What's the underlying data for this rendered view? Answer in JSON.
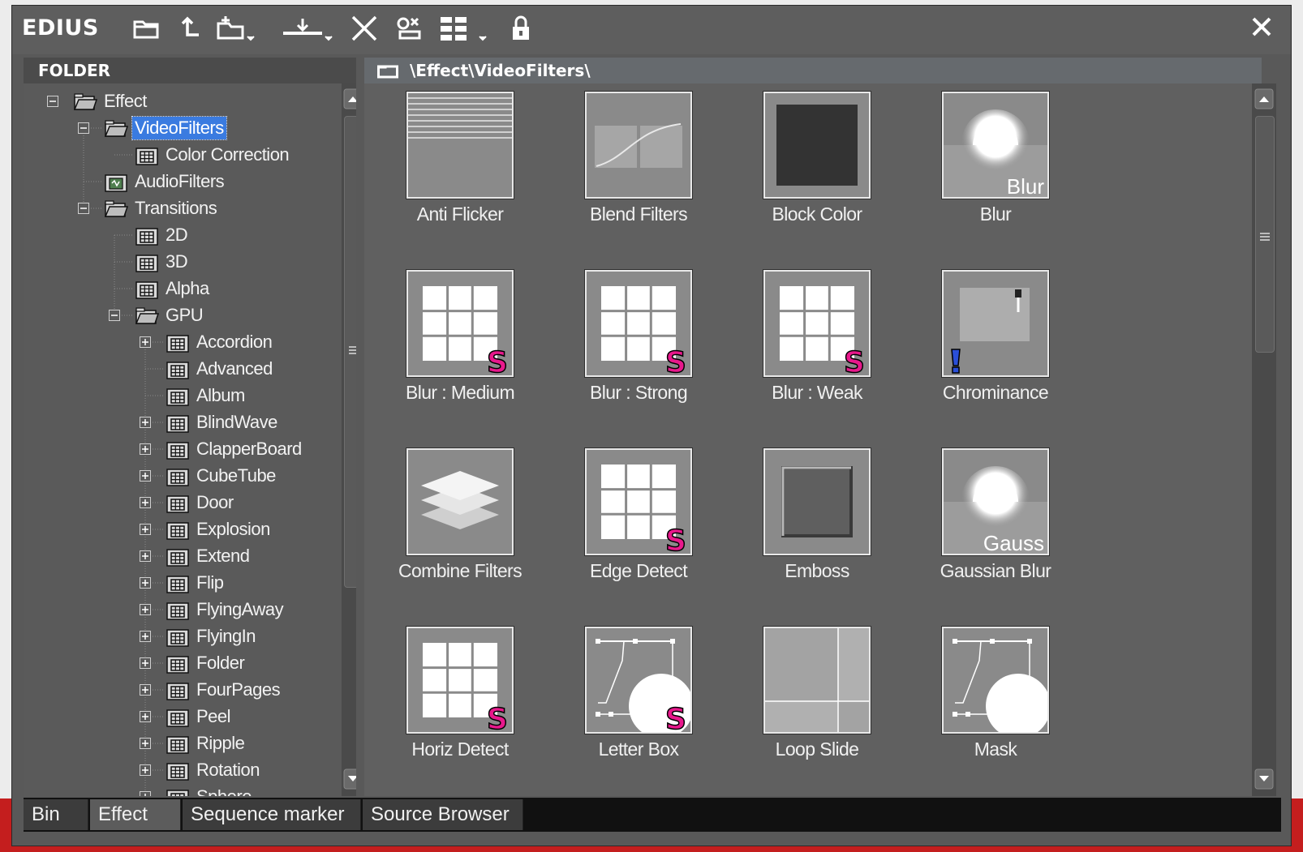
{
  "app": {
    "name": "EDIUS"
  },
  "toolbar": {
    "icons": [
      "folder-icon",
      "up-folder-icon",
      "new-folder-icon",
      "import-icon",
      "delete-icon",
      "properties-icon",
      "view-mode-icon",
      "lock-icon"
    ],
    "close_symbol": "✕"
  },
  "folder_panel": {
    "header": "FOLDER",
    "tree": [
      {
        "label": "Effect",
        "depth": 0,
        "expander": "minus",
        "icon": "open-folder"
      },
      {
        "label": "VideoFilters",
        "depth": 1,
        "expander": "minus",
        "icon": "open-folder",
        "selected": true
      },
      {
        "label": "Color Correction",
        "depth": 2,
        "expander": "none",
        "icon": "grid-folder"
      },
      {
        "label": "AudioFilters",
        "depth": 1,
        "expander": "none",
        "icon": "audio-folder"
      },
      {
        "label": "Transitions",
        "depth": 1,
        "expander": "minus",
        "icon": "open-folder"
      },
      {
        "label": "2D",
        "depth": 2,
        "expander": "none",
        "icon": "grid-folder"
      },
      {
        "label": "3D",
        "depth": 2,
        "expander": "none",
        "icon": "grid-folder"
      },
      {
        "label": "Alpha",
        "depth": 2,
        "expander": "none",
        "icon": "grid-folder"
      },
      {
        "label": "GPU",
        "depth": 2,
        "expander": "minus",
        "icon": "open-folder"
      },
      {
        "label": "Accordion",
        "depth": 3,
        "expander": "plus",
        "icon": "grid-folder"
      },
      {
        "label": "Advanced",
        "depth": 3,
        "expander": "none",
        "icon": "grid-folder"
      },
      {
        "label": "Album",
        "depth": 3,
        "expander": "none",
        "icon": "grid-folder"
      },
      {
        "label": "BlindWave",
        "depth": 3,
        "expander": "plus",
        "icon": "grid-folder"
      },
      {
        "label": "ClapperBoard",
        "depth": 3,
        "expander": "plus",
        "icon": "grid-folder"
      },
      {
        "label": "CubeTube",
        "depth": 3,
        "expander": "plus",
        "icon": "grid-folder"
      },
      {
        "label": "Door",
        "depth": 3,
        "expander": "plus",
        "icon": "grid-folder"
      },
      {
        "label": "Explosion",
        "depth": 3,
        "expander": "plus",
        "icon": "grid-folder"
      },
      {
        "label": "Extend",
        "depth": 3,
        "expander": "plus",
        "icon": "grid-folder"
      },
      {
        "label": "Flip",
        "depth": 3,
        "expander": "plus",
        "icon": "grid-folder"
      },
      {
        "label": "FlyingAway",
        "depth": 3,
        "expander": "plus",
        "icon": "grid-folder"
      },
      {
        "label": "FlyingIn",
        "depth": 3,
        "expander": "plus",
        "icon": "grid-folder"
      },
      {
        "label": "Folder",
        "depth": 3,
        "expander": "plus",
        "icon": "grid-folder"
      },
      {
        "label": "FourPages",
        "depth": 3,
        "expander": "plus",
        "icon": "grid-folder"
      },
      {
        "label": "Peel",
        "depth": 3,
        "expander": "plus",
        "icon": "grid-folder"
      },
      {
        "label": "Ripple",
        "depth": 3,
        "expander": "plus",
        "icon": "grid-folder"
      },
      {
        "label": "Rotation",
        "depth": 3,
        "expander": "plus",
        "icon": "grid-folder"
      },
      {
        "label": "Sphere",
        "depth": 3,
        "expander": "plus",
        "icon": "grid-folder"
      }
    ]
  },
  "content_panel": {
    "path": "\\Effect\\VideoFilters\\",
    "items": [
      {
        "label": "Anti Flicker",
        "thumb": "lines"
      },
      {
        "label": "Blend Filters",
        "thumb": "curve"
      },
      {
        "label": "Block Color",
        "thumb": "block"
      },
      {
        "label": "Blur",
        "thumb": "sun",
        "caption": "Blur"
      },
      {
        "label": "Blur : Medium",
        "thumb": "grid-s"
      },
      {
        "label": "Blur : Strong",
        "thumb": "grid-s"
      },
      {
        "label": "Blur : Weak",
        "thumb": "grid-s"
      },
      {
        "label": "Chrominance",
        "thumb": "chroma"
      },
      {
        "label": "Combine Filters",
        "thumb": "layers"
      },
      {
        "label": "Edge Detect",
        "thumb": "grid-s"
      },
      {
        "label": "Emboss",
        "thumb": "emboss"
      },
      {
        "label": "Gaussian Blur",
        "thumb": "sun",
        "caption": "Gauss"
      },
      {
        "label": "Horiz Detect",
        "thumb": "grid-s"
      },
      {
        "label": "Letter Box",
        "thumb": "mask-s"
      },
      {
        "label": "Loop Slide",
        "thumb": "loop"
      },
      {
        "label": "Mask",
        "thumb": "mask"
      }
    ],
    "badge_letter": "S"
  },
  "tabs": [
    {
      "label": "Bin",
      "active": false
    },
    {
      "label": "Effect",
      "active": true
    },
    {
      "label": "Sequence marker",
      "active": false
    },
    {
      "label": "Source Browser",
      "active": false
    }
  ],
  "colors": {
    "accent_select": "#3a7be0",
    "badge": "#e8188c",
    "red_strip": "#c41e1e"
  }
}
